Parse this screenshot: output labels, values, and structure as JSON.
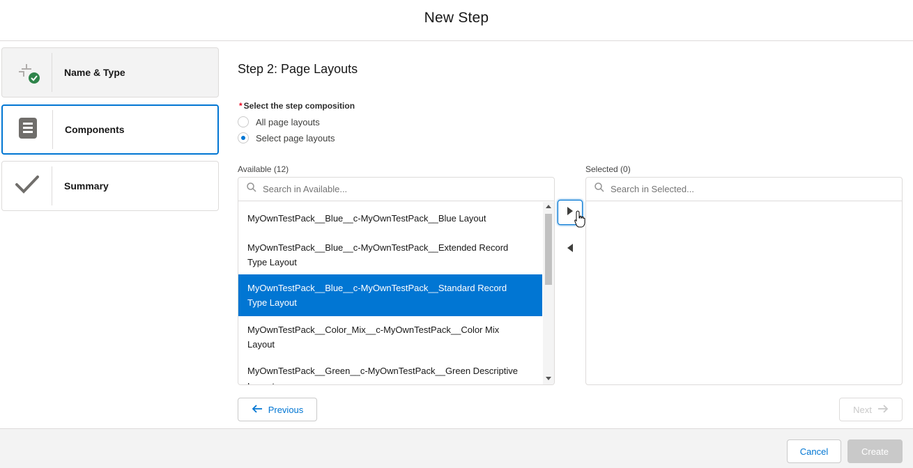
{
  "header": {
    "title": "New Step"
  },
  "steps": [
    {
      "label": "Name & Type",
      "icon": "merge-arrows-check-icon",
      "state": "done"
    },
    {
      "label": "Components",
      "icon": "document-list-icon",
      "state": "active"
    },
    {
      "label": "Summary",
      "icon": "checkmark-icon",
      "state": "pending"
    }
  ],
  "main": {
    "step_title": "Step 2: Page Layouts",
    "composition": {
      "label": "Select the step composition",
      "required_marker": "*",
      "options": [
        {
          "label": "All page layouts",
          "checked": false
        },
        {
          "label": "Select page layouts",
          "checked": true
        }
      ]
    },
    "available": {
      "label": "Available (12)",
      "search_placeholder": "Search in Available...",
      "items": [
        {
          "line1": "MyOwnTestPack__Blue__c-MyOwnTestPack__Blue Layout",
          "line2": "",
          "selected": false
        },
        {
          "line1": "MyOwnTestPack__Blue__c-MyOwnTestPack__Extended Record",
          "line2": "Type Layout",
          "selected": false
        },
        {
          "line1": "MyOwnTestPack__Blue__c-MyOwnTestPack__Standard Record",
          "line2": "Type Layout",
          "selected": true
        },
        {
          "line1": "MyOwnTestPack__Color_Mix__c-MyOwnTestPack__Color Mix",
          "line2": "Layout",
          "selected": false
        },
        {
          "line1": "MyOwnTestPack__Green__c-MyOwnTestPack__Green Descriptive",
          "line2": "Layout",
          "selected": false
        }
      ]
    },
    "selected": {
      "label": "Selected (0)",
      "search_placeholder": "Search in Selected..."
    },
    "nav": {
      "previous_label": "Previous",
      "next_label": "Next"
    }
  },
  "footer": {
    "cancel_label": "Cancel",
    "create_label": "Create"
  },
  "colors": {
    "brand": "#0176d3",
    "success": "#2e844a",
    "icon_gray": "#706e6b",
    "required": "#ea001e"
  }
}
